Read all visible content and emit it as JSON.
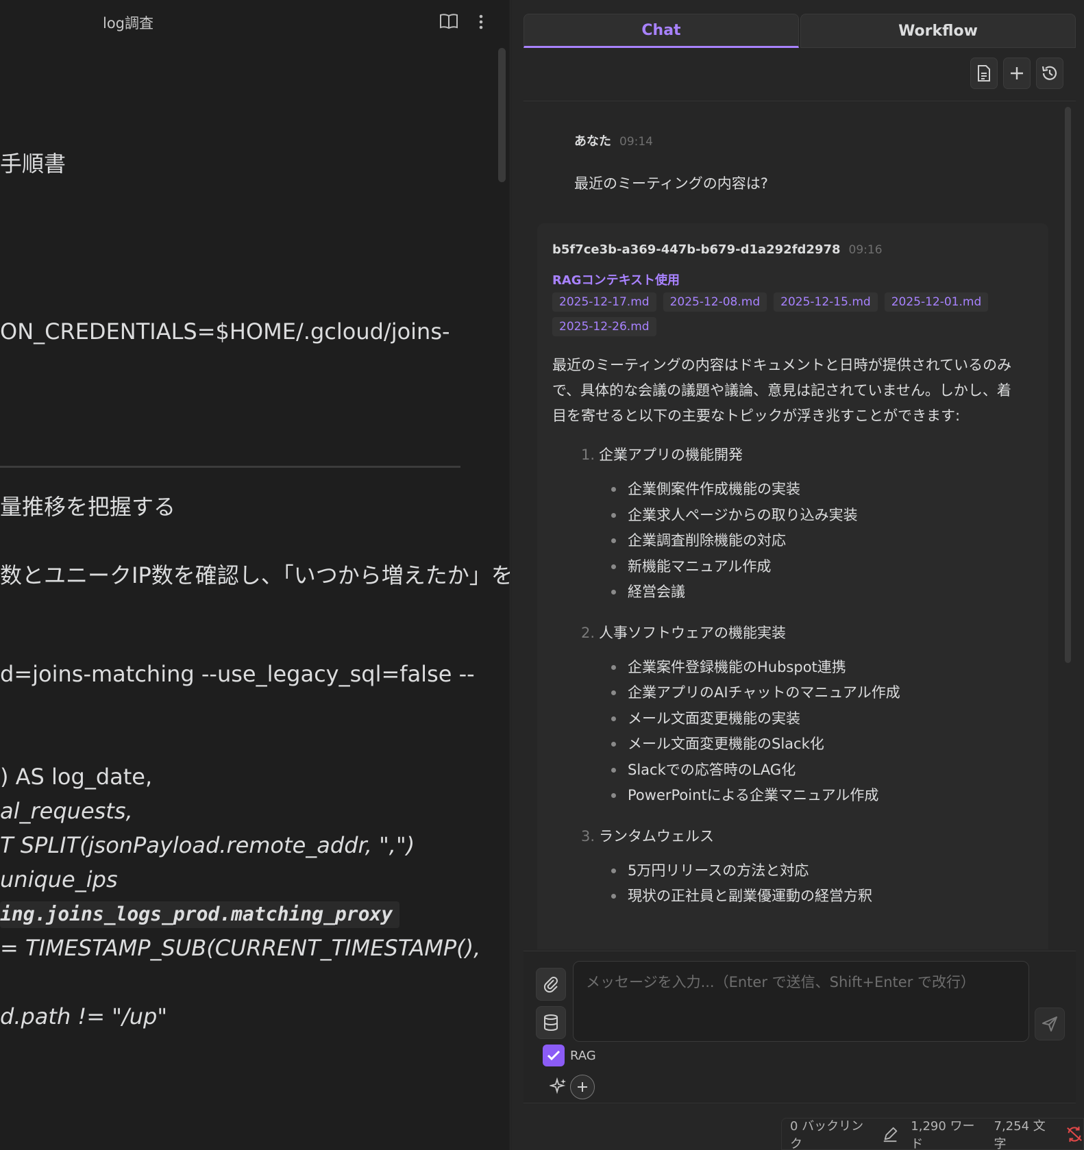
{
  "editor": {
    "title": "log調査",
    "lines": [
      "手順書",
      "ON_CREDENTIALS=$HOME/.gcloud/joins-",
      "量推移を把握する",
      "数とユニークIP数を確認し、「いつから増えたか」を特",
      "d=joins-matching --use_legacy_sql=false --",
      ") AS log_date,",
      "al_requests,",
      "T SPLIT(jsonPayload.remote_addr, \",\")",
      "unique_ips",
      "ing.joins_logs_prod.matching_proxy",
      "= TIMESTAMP_SUB(CURRENT_TIMESTAMP(),",
      "d.path != \"/up\""
    ]
  },
  "tabs": [
    {
      "label": "Chat",
      "active": true
    },
    {
      "label": "Workflow",
      "active": false
    }
  ],
  "toolbar": {
    "icons": [
      "document-icon",
      "plus-icon",
      "history-icon"
    ]
  },
  "messages": {
    "user": {
      "author": "あなた",
      "time": "09:14",
      "text": "最近のミーティングの内容は?"
    },
    "assistant": {
      "author": "b5f7ce3b-a369-447b-b679-d1a292fd2978",
      "time": "09:16",
      "rag_label": "RAGコンテキスト使用",
      "sources": [
        "2025-12-17.md",
        "2025-12-08.md",
        "2025-12-15.md",
        "2025-12-01.md",
        "2025-12-26.md"
      ],
      "intro": "最近のミーティングの内容はドキュメントと日時が提供されているのみで、具体的な会議の議題や議論、意見は記されていません。しかし、着目を寄せると以下の主要なトピックが浮き兆すことができます:",
      "sections": [
        {
          "num": "1.",
          "title": "企業アプリの機能開発",
          "items": [
            "企業側案件作成機能の実装",
            "企業求人ページからの取り込み実装",
            "企業調査削除機能の対応",
            "新機能マニュアル作成",
            "経営会議"
          ]
        },
        {
          "num": "2.",
          "title": "人事ソフトウェアの機能実装",
          "items": [
            "企業案件登録機能のHubspot連携",
            "企業アプリのAIチャットのマニュアル作成",
            "メール文面変更機能の実装",
            "メール文面変更機能のSlack化",
            "Slackでの応答時のLAG化",
            "PowerPointによる企業マニュアル作成"
          ]
        },
        {
          "num": "3.",
          "title": "ランタムウェルス",
          "items": [
            "5万円リリースの方法と対応",
            "現状の正社員と副業優運動の経営方釈"
          ]
        }
      ]
    }
  },
  "input": {
    "placeholder": "メッセージを入力...（Enter で送信、Shift+Enter で改行）",
    "value": "",
    "rag_label": "RAG",
    "rag_checked": true
  },
  "status": {
    "backlinks": "0 バックリンク",
    "words": "1,290 ワード",
    "chars": "7,254 文字"
  },
  "colors": {
    "accent": "#a882ff",
    "checkbox": "#8b5cf6",
    "sync_error": "#e04848"
  }
}
